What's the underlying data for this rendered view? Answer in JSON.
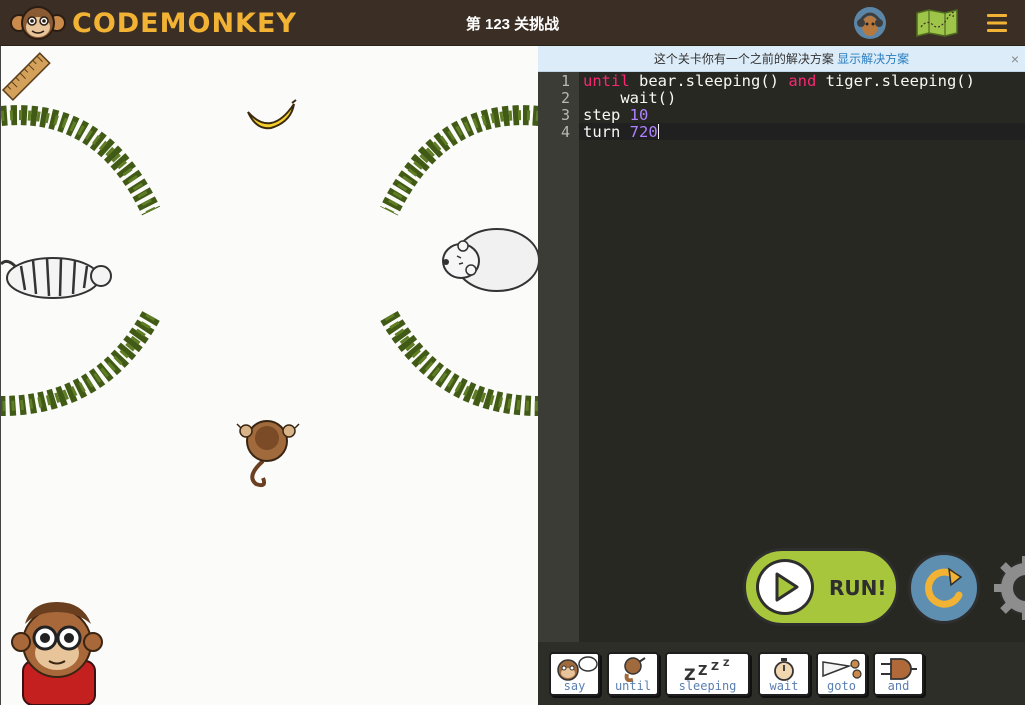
{
  "header": {
    "logo_text": "CODEMONKEY",
    "level_title": "第 123 关挑战"
  },
  "notice": {
    "text": "这个关卡你有一个之前的解决方案",
    "link": "显示解决方案",
    "close": "×"
  },
  "editor": {
    "line_numbers": [
      "1",
      "2",
      "3",
      "4"
    ],
    "lines": [
      {
        "kw1": "until",
        "text1": " bear.sleeping() ",
        "kw2": "and",
        "text2": " tiger.sleeping()"
      },
      {
        "text": "    wait()"
      },
      {
        "cmd": "step ",
        "num": "10"
      },
      {
        "cmd": "turn ",
        "num": "720"
      }
    ]
  },
  "controls": {
    "run_label": "RUN!"
  },
  "palette": [
    {
      "label": "say",
      "icon": "monkey-speech-icon"
    },
    {
      "label": "until",
      "icon": "monkey-hand-icon"
    },
    {
      "label": "sleeping",
      "icon": "zzz-icon"
    },
    {
      "label": "wait",
      "icon": "stopwatch-icon"
    },
    {
      "label": "goto",
      "icon": "goto-icon"
    },
    {
      "label": "and",
      "icon": "and-gate-icon"
    }
  ],
  "colors": {
    "header_bg": "#3b2f25",
    "logo": "#f2b233",
    "run_green": "#a7c63c",
    "reset_blue": "#5e8fb0",
    "keyword": "#f92672",
    "number": "#ae81ff",
    "link": "#2a7ec0"
  }
}
